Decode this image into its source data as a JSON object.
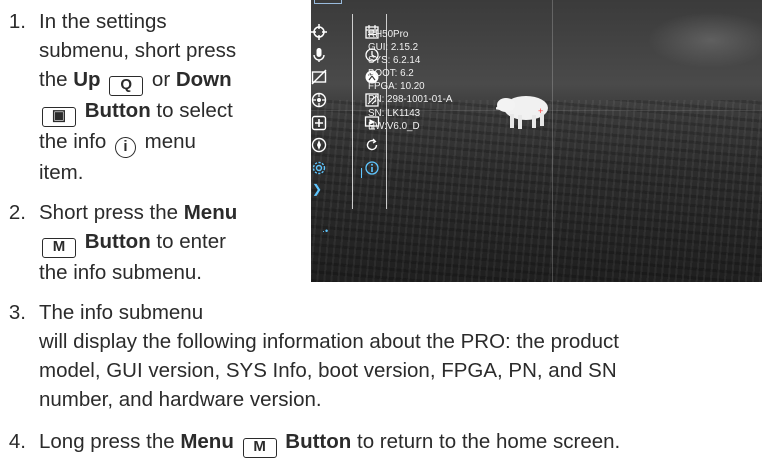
{
  "steps": [
    {
      "num": "1.",
      "text_1": "In the settings",
      "text_2": "submenu, short press",
      "text_3": "the ",
      "up_bold": "Up",
      "up_key": "Q",
      "or_text": " or ",
      "down_bold": "Down",
      "down_key": "▣",
      "button_bold": "Button",
      "text_4": " to select",
      "text_5": "the info ",
      "info_glyph": "i",
      "text_6": " menu",
      "text_7": "item."
    },
    {
      "num": "2.",
      "text_1": "Short press the ",
      "menu_bold": "Menu",
      "menu_key": "M",
      "button_bold": "Button",
      "text_2": " to enter",
      "text_3": "the info submenu."
    },
    {
      "num": "3.",
      "line_1": "The info submenu",
      "line_2": "will display the following information about the PRO: the product",
      "line_3": "model, GUI version, SYS Info, boot version, FPGA, PN, and SN",
      "line_4": "number, and hardware version."
    },
    {
      "num": "4.",
      "text_1": "Long press the ",
      "menu_bold": "Menu",
      "menu_key": "M",
      "button_bold": "Button",
      "text_2": " to return to the home screen."
    }
  ],
  "screen": {
    "info_lines": [
      "RH50Pro",
      "GUI: 2.15.2",
      "SYS: 6.2.14",
      "BOOT: 6.2",
      "FPGA: 10.20",
      "PN: 298-1001-01-A",
      "SN: LK1143",
      "HW:V6.0_D"
    ],
    "menu_left_icons": [
      "crosshair-icon",
      "microphone-icon",
      "screen-off-icon",
      "palette-icon",
      "zoom-box-icon",
      "compass-icon",
      "settings-gear-icon"
    ],
    "menu_sub_icons": [
      "calendar-icon",
      "clock-icon",
      "language-icon",
      "reset-image-icon",
      "display-icon",
      "restore-icon",
      "info-icon"
    ],
    "selected_sub": "info-icon",
    "accent_color": "#5fc6ff"
  }
}
